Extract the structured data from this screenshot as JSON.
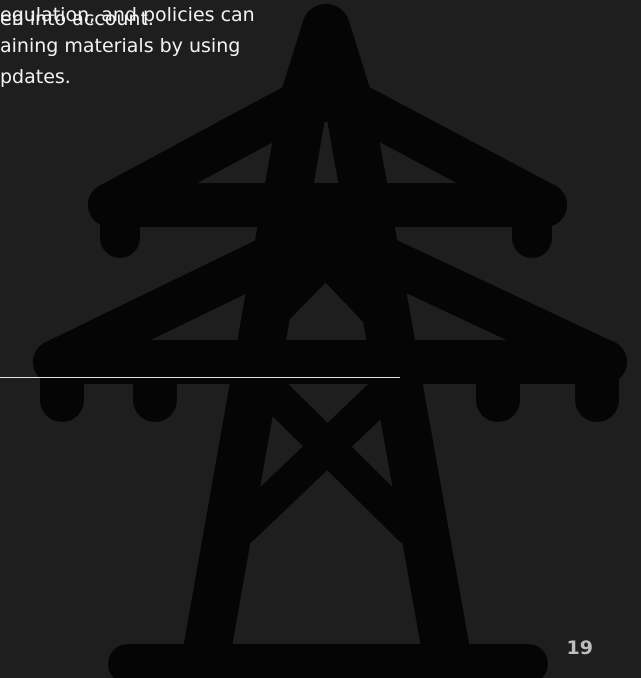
{
  "top_text": "en into account.",
  "paragraph": {
    "line1": "egulation, and policies can",
    "line2": "aining materials by using",
    "line3": "pdates."
  },
  "page_number": "19",
  "colors": {
    "background": "#1e1e1e",
    "tower": "#050505",
    "text": "#f2f2f2",
    "page_number": "#bdbdbd"
  },
  "icons": {
    "background_graphic": "power-transmission-tower-icon"
  }
}
